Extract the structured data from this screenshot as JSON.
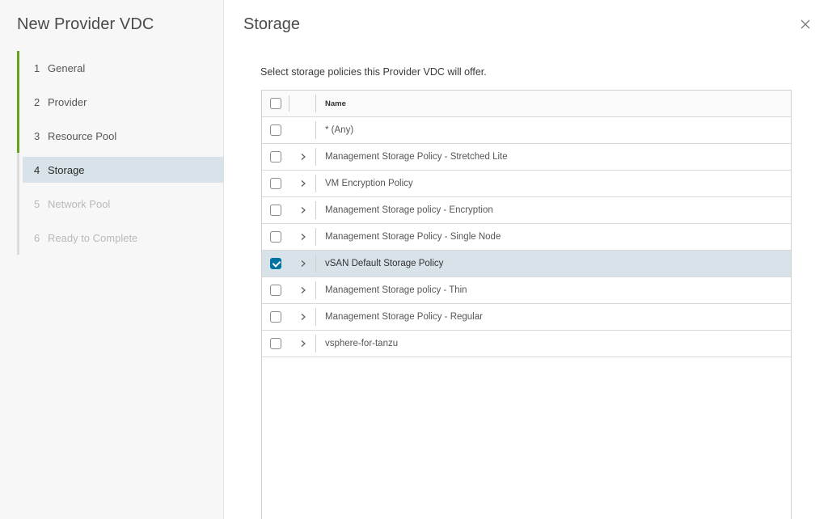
{
  "wizard": {
    "title": "New Provider VDC",
    "steps": [
      {
        "num": "1",
        "label": "General",
        "state": "done"
      },
      {
        "num": "2",
        "label": "Provider",
        "state": "done"
      },
      {
        "num": "3",
        "label": "Resource Pool",
        "state": "done"
      },
      {
        "num": "4",
        "label": "Storage",
        "state": "current"
      },
      {
        "num": "5",
        "label": "Network Pool",
        "state": "disabled"
      },
      {
        "num": "6",
        "label": "Ready to Complete",
        "state": "disabled"
      }
    ]
  },
  "page": {
    "title": "Storage",
    "description": "Select storage policies this Provider VDC will offer.",
    "close_icon": "close-icon"
  },
  "grid": {
    "column_name": "Name",
    "rows": [
      {
        "name": "* (Any)",
        "checked": false,
        "expandable": false
      },
      {
        "name": "Management Storage Policy - Stretched Lite",
        "checked": false,
        "expandable": true
      },
      {
        "name": "VM Encryption Policy",
        "checked": false,
        "expandable": true
      },
      {
        "name": "Management Storage policy - Encryption",
        "checked": false,
        "expandable": true
      },
      {
        "name": "Management Storage Policy - Single Node",
        "checked": false,
        "expandable": true
      },
      {
        "name": "vSAN Default Storage Policy",
        "checked": true,
        "expandable": true
      },
      {
        "name": "Management Storage policy - Thin",
        "checked": false,
        "expandable": true
      },
      {
        "name": "Management Storage Policy - Regular",
        "checked": false,
        "expandable": true
      },
      {
        "name": "vsphere-for-tanzu",
        "checked": false,
        "expandable": true
      }
    ]
  },
  "colors": {
    "step_done": "#62a420",
    "step_current_bg": "#d8e3e9",
    "checkbox_checked": "#0072a3",
    "selected_row": "#d8e3e9"
  }
}
